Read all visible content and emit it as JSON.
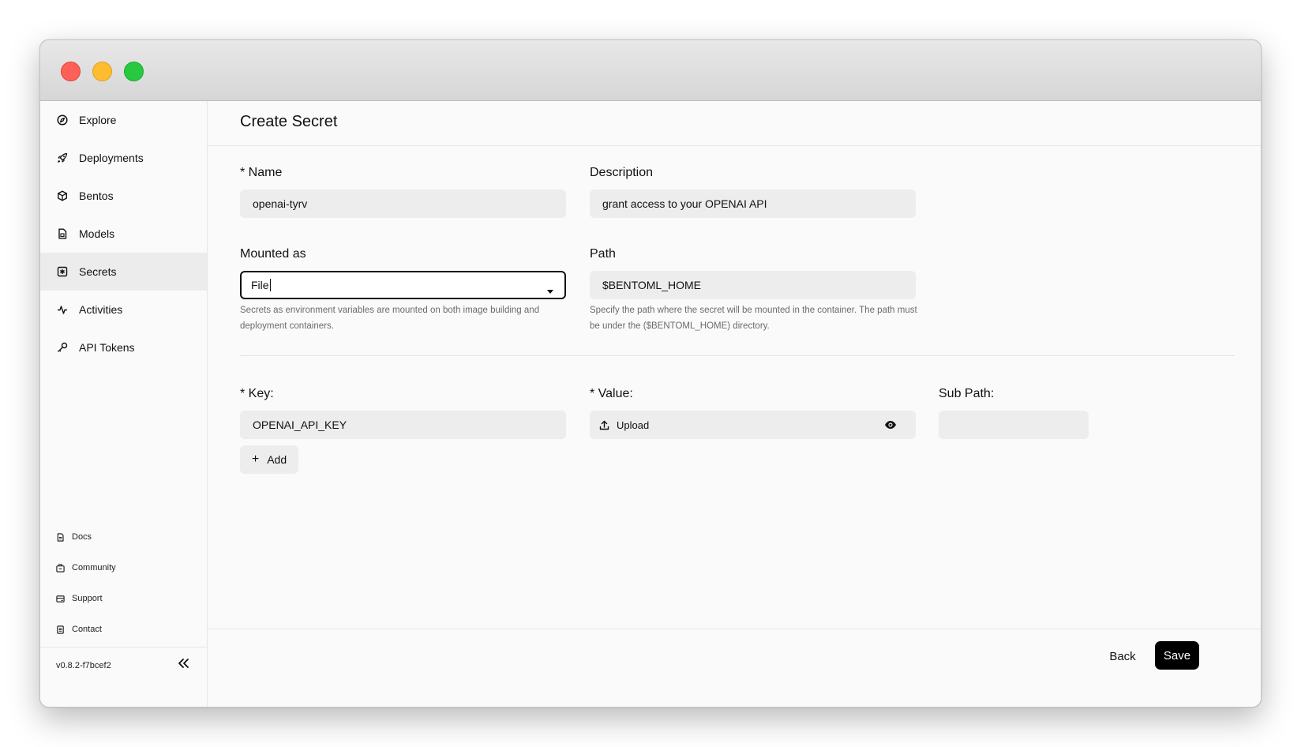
{
  "sidebar": {
    "nav": [
      {
        "label": "Explore",
        "icon": "compass-icon"
      },
      {
        "label": "Deployments",
        "icon": "rocket-icon"
      },
      {
        "label": "Bentos",
        "icon": "cube-icon"
      },
      {
        "label": "Models",
        "icon": "document-icon"
      },
      {
        "label": "Secrets",
        "icon": "secret-icon",
        "active": true
      },
      {
        "label": "Activities",
        "icon": "activity-icon"
      },
      {
        "label": "API Tokens",
        "icon": "key-icon"
      }
    ],
    "footer": [
      {
        "label": "Docs",
        "icon": "docs-icon"
      },
      {
        "label": "Community",
        "icon": "community-icon"
      },
      {
        "label": "Support",
        "icon": "support-icon"
      },
      {
        "label": "Contact",
        "icon": "contact-icon"
      }
    ],
    "version": "v0.8.2-f7bcef2"
  },
  "page": {
    "title": "Create Secret"
  },
  "form": {
    "name_label": "* Name",
    "name_value": "openai-tyrv",
    "description_label": "Description",
    "description_value": "grant access to your OPENAI API",
    "mounted_label": "Mounted as",
    "mounted_value": "File",
    "mounted_help": "Secrets as environment variables are mounted on both image building and deployment containers.",
    "path_label": "Path",
    "path_value": "$BENTOML_HOME",
    "path_help": "Specify the path where the secret will be mounted in the container. The path must be under the ($BENTOML_HOME) directory.",
    "key_label": "* Key:",
    "key_value": "OPENAI_API_KEY",
    "value_label": "* Value:",
    "upload_label": "Upload",
    "subpath_label": "Sub Path:",
    "subpath_value": "",
    "add_label": "Add"
  },
  "footer": {
    "back_label": "Back",
    "save_label": "Save"
  }
}
